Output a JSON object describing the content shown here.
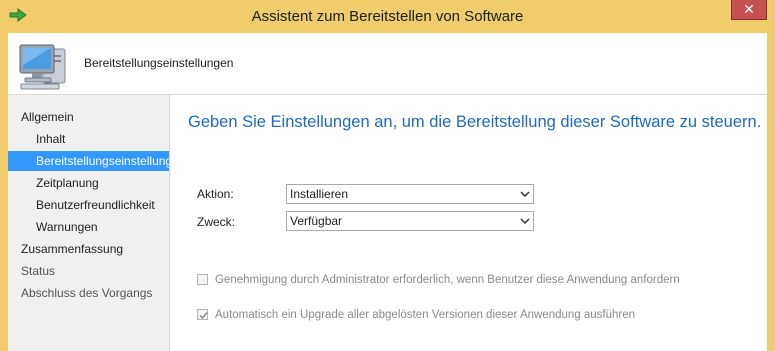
{
  "window": {
    "title": "Assistent zum Bereitstellen von Software",
    "close_label": "✕"
  },
  "header": {
    "title": "Bereitstellungseinstellungen"
  },
  "sidebar": {
    "items": [
      {
        "label": "Allgemein"
      },
      {
        "label": "Inhalt"
      },
      {
        "label": "Bereitstellungseinstellungen"
      },
      {
        "label": "Zeitplanung"
      },
      {
        "label": "Benutzerfreundlichkeit"
      },
      {
        "label": "Warnungen"
      },
      {
        "label": "Zusammenfassung"
      },
      {
        "label": "Status"
      },
      {
        "label": "Abschluss des Vorgangs"
      }
    ]
  },
  "main": {
    "heading": "Geben Sie Einstellungen an, um die Bereitstellung dieser Software zu steuern.",
    "action": {
      "label": "Aktion:",
      "value": "Installieren"
    },
    "purpose": {
      "label": "Zweck:",
      "value": "Verfügbar"
    },
    "checkboxes": [
      {
        "label": "Genehmigung durch Administrator erforderlich, wenn Benutzer diese Anwendung anfordern",
        "checked": false
      },
      {
        "label": "Automatisch ein Upgrade aller abgelösten Versionen dieser Anwendung ausführen",
        "checked": true
      }
    ]
  },
  "colors": {
    "title_bar": "#f1cc6c",
    "selected": "#3399ff",
    "heading": "#1e6bb8",
    "close": "#c75050"
  }
}
